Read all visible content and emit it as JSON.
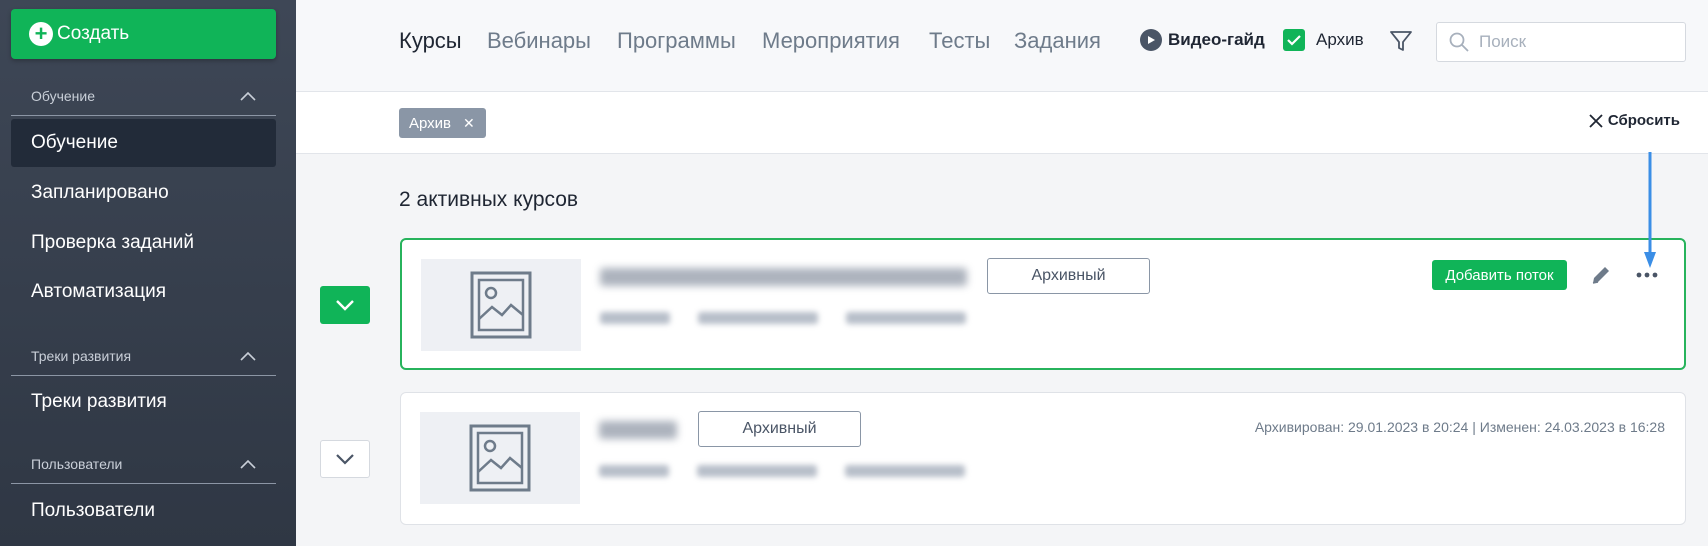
{
  "sidebar": {
    "create_label": "Создать",
    "sections": [
      {
        "title": "Обучение",
        "items": [
          "Обучение",
          "Запланировано",
          "Проверка заданий",
          "Автоматизация"
        ]
      },
      {
        "title": "Треки развития",
        "items": [
          "Треки развития"
        ]
      },
      {
        "title": "Пользователи",
        "items": [
          "Пользователи"
        ]
      }
    ],
    "active_item": "Обучение"
  },
  "header": {
    "tabs": [
      "Курсы",
      "Вебинары",
      "Программы",
      "Мероприятия",
      "Тесты",
      "Задания"
    ],
    "active_tab": "Курсы",
    "video_guide_label": "Видео-гайд",
    "archive_label": "Архив",
    "archive_checked": true,
    "search_placeholder": "Поиск"
  },
  "filters": {
    "chips": [
      "Архив"
    ],
    "reset_label": "Сбросить"
  },
  "main": {
    "count_label": "2 активных курсов",
    "courses": [
      {
        "status_badge": "Архивный",
        "add_stream_label": "Добавить поток",
        "expanded": true
      },
      {
        "status_badge": "Архивный",
        "dates": "Архивирован: 29.01.2023 в 20:24 | Изменен: 24.03.2023 в 16:28",
        "expanded": false
      }
    ]
  },
  "colors": {
    "accent_green": "#10b458",
    "sidebar_bg": "#3e4756",
    "annotation_arrow": "#3b8ee6"
  }
}
